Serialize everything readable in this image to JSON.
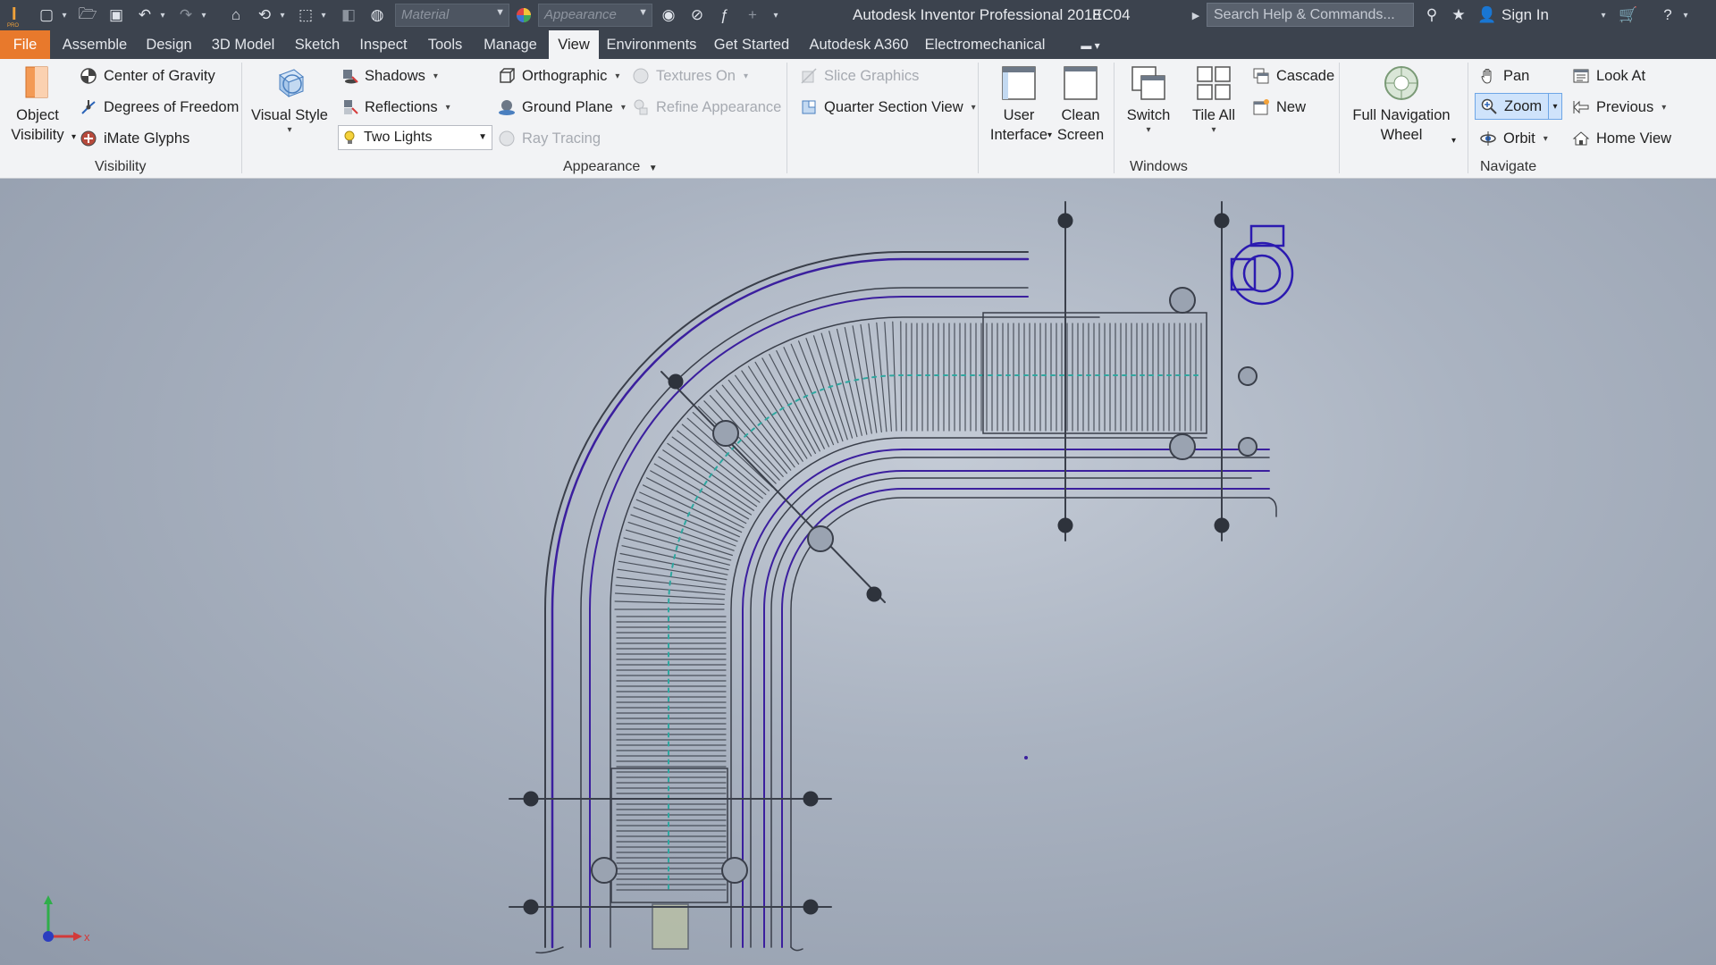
{
  "titlebar": {
    "material_placeholder": "Material",
    "appearance_placeholder": "Appearance",
    "window_title": "Autodesk Inventor Professional 2018",
    "document_name": "EC04",
    "search_placeholder": "Search Help & Commands...",
    "sign_in": "Sign In"
  },
  "tabs": [
    "File",
    "Assemble",
    "Design",
    "3D Model",
    "Sketch",
    "Inspect",
    "Tools",
    "Manage",
    "View",
    "Environments",
    "Get Started",
    "Autodesk A360",
    "Electromechanical"
  ],
  "active_tab": "View",
  "ribbon": {
    "visibility": {
      "label": "Visibility",
      "object_visibility_line1": "Object",
      "object_visibility_line2": "Visibility",
      "center_of_gravity": "Center of Gravity",
      "degrees_of_freedom": "Degrees of Freedom",
      "imate_glyphs": "iMate Glyphs"
    },
    "appearance": {
      "label": "Appearance",
      "visual_style": "Visual Style",
      "shadows": "Shadows",
      "reflections": "Reflections",
      "lighting": "Two Lights",
      "orthographic": "Orthographic",
      "ground_plane": "Ground Plane",
      "textures_on": "Textures On",
      "refine_appearance": "Refine Appearance",
      "ray_tracing": "Ray Tracing",
      "slice_graphics": "Slice Graphics",
      "quarter_section_view": "Quarter Section View"
    },
    "windows": {
      "label": "Windows",
      "user_interface_line1": "User",
      "user_interface_line2": "Interface",
      "clean_screen_line1": "Clean",
      "clean_screen_line2": "Screen",
      "switch": "Switch",
      "tile_all": "Tile All",
      "cascade": "Cascade",
      "new": "New"
    },
    "navigate": {
      "label": "Navigate",
      "full_navigation_wheel_line1": "Full Navigation",
      "full_navigation_wheel_line2": "Wheel",
      "pan": "Pan",
      "zoom": "Zoom",
      "orbit": "Orbit",
      "look_at": "Look At",
      "previous": "Previous",
      "home_view": "Home View"
    }
  },
  "triad": {
    "x_label": "x"
  },
  "colors": {
    "title_bg": "#3c434e",
    "file_tab": "#e8792c",
    "ribbon_bg": "#f2f3f5",
    "model_lines": "#3a3f4a",
    "model_accent": "#3b1f9e",
    "model_teal": "#2fa7a0"
  }
}
